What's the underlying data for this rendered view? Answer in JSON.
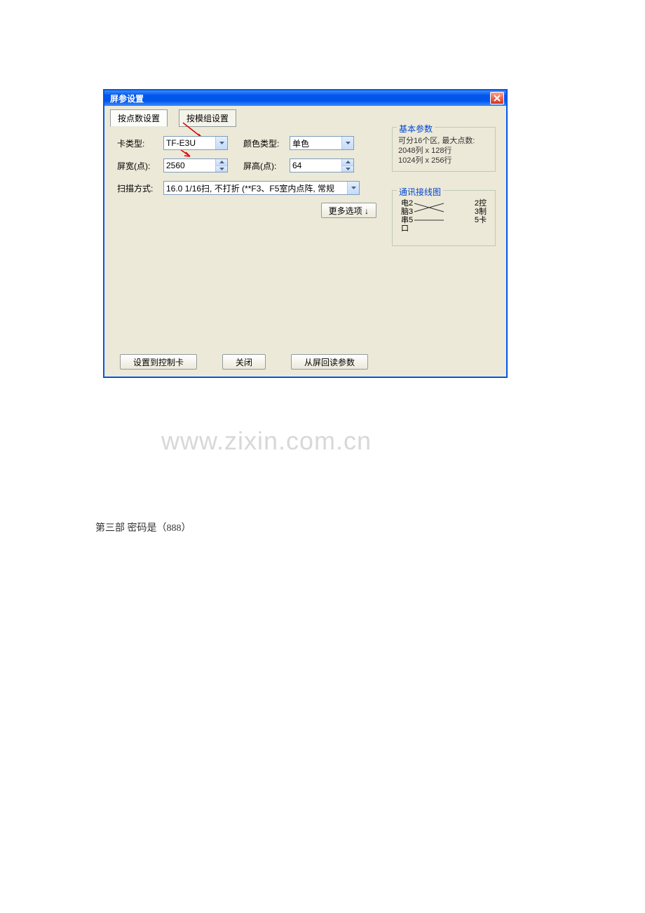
{
  "window": {
    "title": "屏参设置"
  },
  "tabs": {
    "tab1": "按点数设置",
    "tab2": "按模组设置"
  },
  "labels": {
    "card_type": "卡类型:",
    "color_type": "颜色类型:",
    "screen_width": "屏宽(点):",
    "screen_height": "屏高(点):",
    "scan_mode": "扫描方式:"
  },
  "values": {
    "card_type": "TF-E3U",
    "color_type": "单色",
    "screen_width": "2560",
    "screen_height": "64",
    "scan_mode": "16.0 1/16扫, 不打折 (**F3、F5室内点阵, 常规"
  },
  "buttons": {
    "more_options": "更多选项 ↓",
    "set_to_card": "设置到控制卡",
    "close": "关闭",
    "read_from_screen": "从屏回读参数"
  },
  "sidebox1": {
    "title": "基本参数",
    "line1": "可分16个区, 最大点数:",
    "line2": "2048列 x 128行",
    "line3": "1024列 x 256行"
  },
  "sidebox2": {
    "title": "通讯接线图",
    "left_label": "电脑串口",
    "right_label": "控制卡",
    "pins_left": [
      "2",
      "3",
      "5"
    ],
    "pins_right": [
      "2",
      "3",
      "5"
    ]
  },
  "watermark": "www.zixin.com.cn",
  "caption": "第三部 密码是（888）"
}
